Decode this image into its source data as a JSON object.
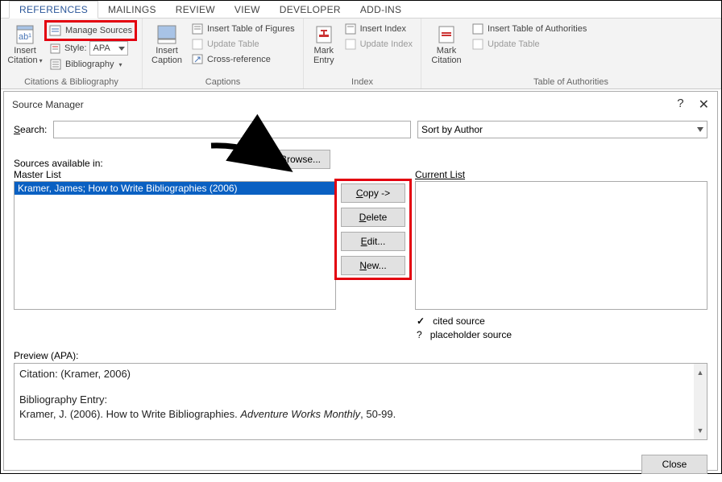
{
  "ribbon": {
    "tabs": [
      "REFERENCES",
      "MAILINGS",
      "REVIEW",
      "VIEW",
      "DEVELOPER",
      "ADD-INS"
    ],
    "active_tab": "REFERENCES",
    "groups": {
      "citations": {
        "insert_citation_label": "Insert Citation",
        "manage_sources_label": "Manage Sources",
        "style_label": "Style:",
        "style_value": "APA",
        "bibliography_label": "Bibliography",
        "group_label": "Citations & Bibliography"
      },
      "captions": {
        "insert_caption_label": "Insert Caption",
        "insert_tof_label": "Insert Table of Figures",
        "update_table_label": "Update Table",
        "cross_ref_label": "Cross-reference",
        "group_label": "Captions"
      },
      "index": {
        "mark_entry_label": "Mark Entry",
        "insert_index_label": "Insert Index",
        "update_index_label": "Update Index",
        "group_label": "Index"
      },
      "toa": {
        "mark_citation_label": "Mark Citation",
        "insert_toa_label": "Insert Table of Authorities",
        "update_table_label": "Update Table",
        "group_label": "Table of Authorities"
      }
    }
  },
  "dialog": {
    "title": "Source Manager",
    "search_label_pre": "S",
    "search_label_post": "earch:",
    "sort_value": "Sort by Author",
    "sources_available_label": "Sources available in:",
    "browse_label_pre": "B",
    "browse_label_post": "rowse...",
    "master_list_label": "Master List",
    "current_list_label": "Current List",
    "master_items": [
      "Kramer, James; How to Write Bibliographies (2006)"
    ],
    "buttons": {
      "copy_pre": "C",
      "copy_post": "opy ->",
      "delete_pre": "D",
      "delete_post": "elete",
      "edit_pre": "E",
      "edit_post": "dit...",
      "new_pre": "N",
      "new_post": "ew..."
    },
    "legend": {
      "cited": "cited source",
      "placeholder": "placeholder source"
    },
    "preview_label": "Preview (APA):",
    "preview": {
      "citation_line": "Citation:  (Kramer, 2006)",
      "bib_heading": "Bibliography Entry:",
      "bib_line_pre": "Kramer, J. (2006). How to Write Bibliographies. ",
      "bib_line_italic": "Adventure Works Monthly",
      "bib_line_post": ", 50-99."
    },
    "close_label": "Close"
  }
}
